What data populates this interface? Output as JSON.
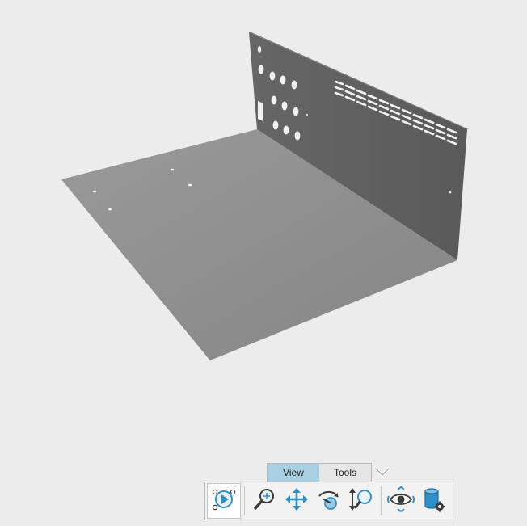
{
  "viewport": {
    "model_name": "sheet-metal-chassis",
    "background_color": "#ececec",
    "floor_color": "#8e8e8e",
    "wall_color": "#5e5e5e"
  },
  "toolbar": {
    "tabs": [
      {
        "label": "View",
        "active": true
      },
      {
        "label": "Tools",
        "active": false
      }
    ],
    "expand_icon": "chevron-down-icon",
    "buttons": [
      {
        "name": "orbit-play-button",
        "icon": "orbit-play-icon",
        "active": true
      },
      {
        "name": "zoom-button",
        "icon": "magnifier-icon",
        "active": false
      },
      {
        "name": "pan-button",
        "icon": "pan-arrows-icon",
        "active": false
      },
      {
        "name": "rotate-button",
        "icon": "rotate-hand-icon",
        "active": false
      },
      {
        "name": "zoom-vertical-button",
        "icon": "zoom-vertical-icon",
        "active": false
      },
      {
        "name": "look-around-button",
        "icon": "eye-orbit-icon",
        "active": false
      },
      {
        "name": "model-settings-button",
        "icon": "database-gear-icon",
        "active": false
      }
    ],
    "accent_color": "#2f8fc9",
    "active_tab_color": "#a8cfe2"
  }
}
